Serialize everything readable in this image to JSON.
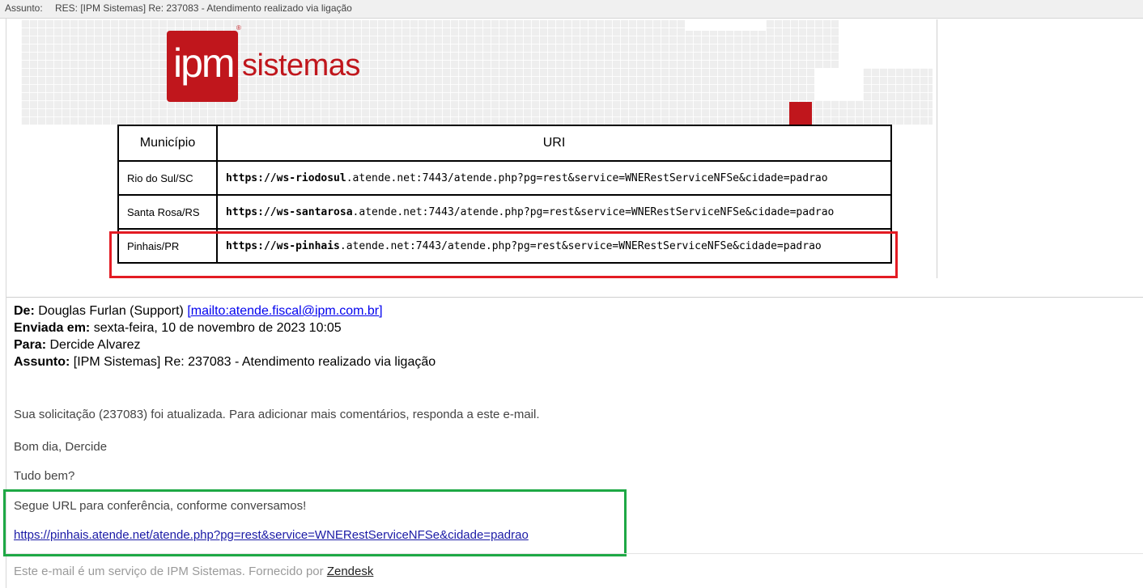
{
  "subject_bar": {
    "label": "Assunto:",
    "value": "RES: [IPM Sistemas] Re: 237083 - Atendimento realizado via ligação"
  },
  "logo": {
    "mark": "ipm",
    "name": "sistemas",
    "registered": "®"
  },
  "table": {
    "headers": [
      "Município",
      "URI"
    ],
    "rows": [
      {
        "municipio": "Rio do Sul/SC",
        "uri_prefix": "https://ws-",
        "uri_bold": "riodosul",
        "uri_suffix": ".atende.net:7443/atende.php?pg=rest&service=WNERestServiceNFSe&cidade=padrao"
      },
      {
        "municipio": "Santa Rosa/RS",
        "uri_prefix": "https://ws-",
        "uri_bold": "santarosa",
        "uri_suffix": ".atende.net:7443/atende.php?pg=rest&service=WNERestServiceNFSe&cidade=padrao"
      },
      {
        "municipio": "Pinhais/PR",
        "uri_prefix": "https://ws-",
        "uri_bold": "pinhais",
        "uri_suffix": ".atende.net:7443/atende.php?pg=rest&service=WNERestServiceNFSe&cidade=padrao"
      }
    ]
  },
  "email": {
    "from_label": "De:",
    "from_name": "Douglas Furlan (Support)",
    "from_link": "[mailto:atende.fiscal@ipm.com.br]",
    "sent_label": "Enviada em:",
    "sent_value": "sexta-feira, 10 de novembro de 2023 10:05",
    "to_label": "Para:",
    "to_value": "Dercide Alvarez",
    "subject_label": "Assunto:",
    "subject_value": "[IPM Sistemas] Re: 237083 - Atendimento realizado via ligação"
  },
  "body": {
    "line1": "Sua solicitação (237083) foi atualizada. Para adicionar mais comentários, responda a este e-mail.",
    "greeting": "Bom dia, Dercide",
    "line3": "Tudo bem?",
    "line4": "Segue URL para conferência, conforme conversamos!",
    "link": "https://pinhais.atende.net/atende.php?pg=rest&service=WNERestServiceNFSe&cidade=padrao"
  },
  "footer": {
    "text": "Este e-mail é um serviço de IPM Sistemas. Fornecido por",
    "link": "Zendesk"
  },
  "colors": {
    "brand_red": "#c0161c",
    "highlight_red": "#e31b23",
    "highlight_green": "#1ea845",
    "link_blue": "#0000ee"
  }
}
